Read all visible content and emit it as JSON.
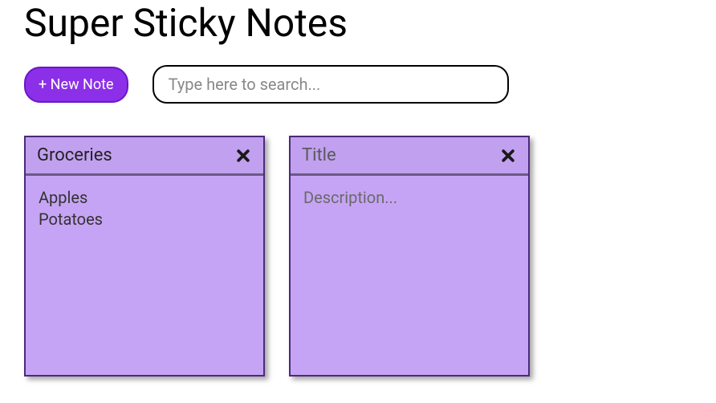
{
  "app": {
    "title": "Super Sticky Notes"
  },
  "controls": {
    "new_note_label": "+ New Note",
    "search_placeholder": "Type here to search...",
    "search_value": ""
  },
  "notes": [
    {
      "title_value": "Groceries",
      "title_placeholder": "Title",
      "close_icon": "close-icon",
      "body_value": "Apples\nPotatoes",
      "body_placeholder": "Description..."
    },
    {
      "title_value": "",
      "title_placeholder": "Title",
      "close_icon": "close-icon",
      "body_value": "",
      "body_placeholder": "Description..."
    }
  ],
  "colors": {
    "note_bg": "#c6a4f5",
    "note_border": "#4a2b7a",
    "btn_bg": "#8c2fe8"
  }
}
